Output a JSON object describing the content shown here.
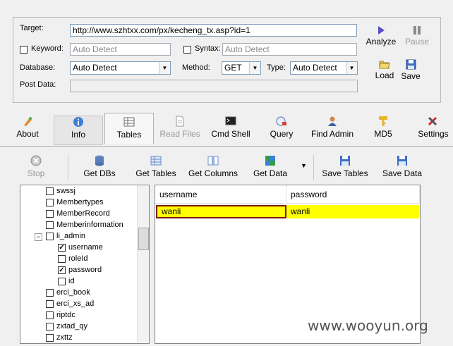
{
  "form": {
    "target_label": "Target:",
    "target_value": "http://www.szhtxx.com/px/kecheng_tx.asp?id=1",
    "keyword_label": "Keyword:",
    "keyword_placeholder": "Auto Detect",
    "syntax_label": "Syntax:",
    "syntax_placeholder": "Auto Detect",
    "database_label": "Database:",
    "database_value": "Auto Detect",
    "method_label": "Method:",
    "method_value": "GET",
    "type_label": "Type:",
    "type_value": "Auto Detect",
    "postdata_label": "Post Data:"
  },
  "actions": {
    "analyze": "Analyze",
    "pause": "Pause",
    "load": "Load",
    "save": "Save"
  },
  "tabs": [
    {
      "label": "About"
    },
    {
      "label": "Info"
    },
    {
      "label": "Tables"
    },
    {
      "label": "Read Files"
    },
    {
      "label": "Cmd Shell"
    },
    {
      "label": "Query"
    },
    {
      "label": "Find Admin"
    },
    {
      "label": "MD5"
    },
    {
      "label": "Settings"
    }
  ],
  "toolbar": {
    "stop": "Stop",
    "get_dbs": "Get DBs",
    "get_tables": "Get Tables",
    "get_columns": "Get Columns",
    "get_data": "Get Data",
    "save_tables": "Save Tables",
    "save_data": "Save Data"
  },
  "tree": [
    {
      "label": "swssj",
      "checked": false
    },
    {
      "label": "Membertypes",
      "checked": false
    },
    {
      "label": "MemberRecord",
      "checked": false
    },
    {
      "label": "Memberinformation",
      "checked": false
    },
    {
      "label": "li_admin",
      "checked": false
    },
    {
      "label": "username",
      "checked": true
    },
    {
      "label": "roleId",
      "checked": false
    },
    {
      "label": "password",
      "checked": true
    },
    {
      "label": "id",
      "checked": false
    },
    {
      "label": "erci_book",
      "checked": false
    },
    {
      "label": "erci_xs_ad",
      "checked": false
    },
    {
      "label": "riptdc",
      "checked": false
    },
    {
      "label": "zxtad_qy",
      "checked": false
    },
    {
      "label": "zxttz",
      "checked": false
    }
  ],
  "grid": {
    "columns": [
      "username",
      "password"
    ],
    "rows": [
      [
        "wanli",
        "wanli"
      ]
    ]
  },
  "watermark": "www.wooyun.org",
  "colors": {
    "row_highlight": "#ffff00",
    "focus_border": "#7a1b1b",
    "panel_bg": "#f0f0f0"
  }
}
